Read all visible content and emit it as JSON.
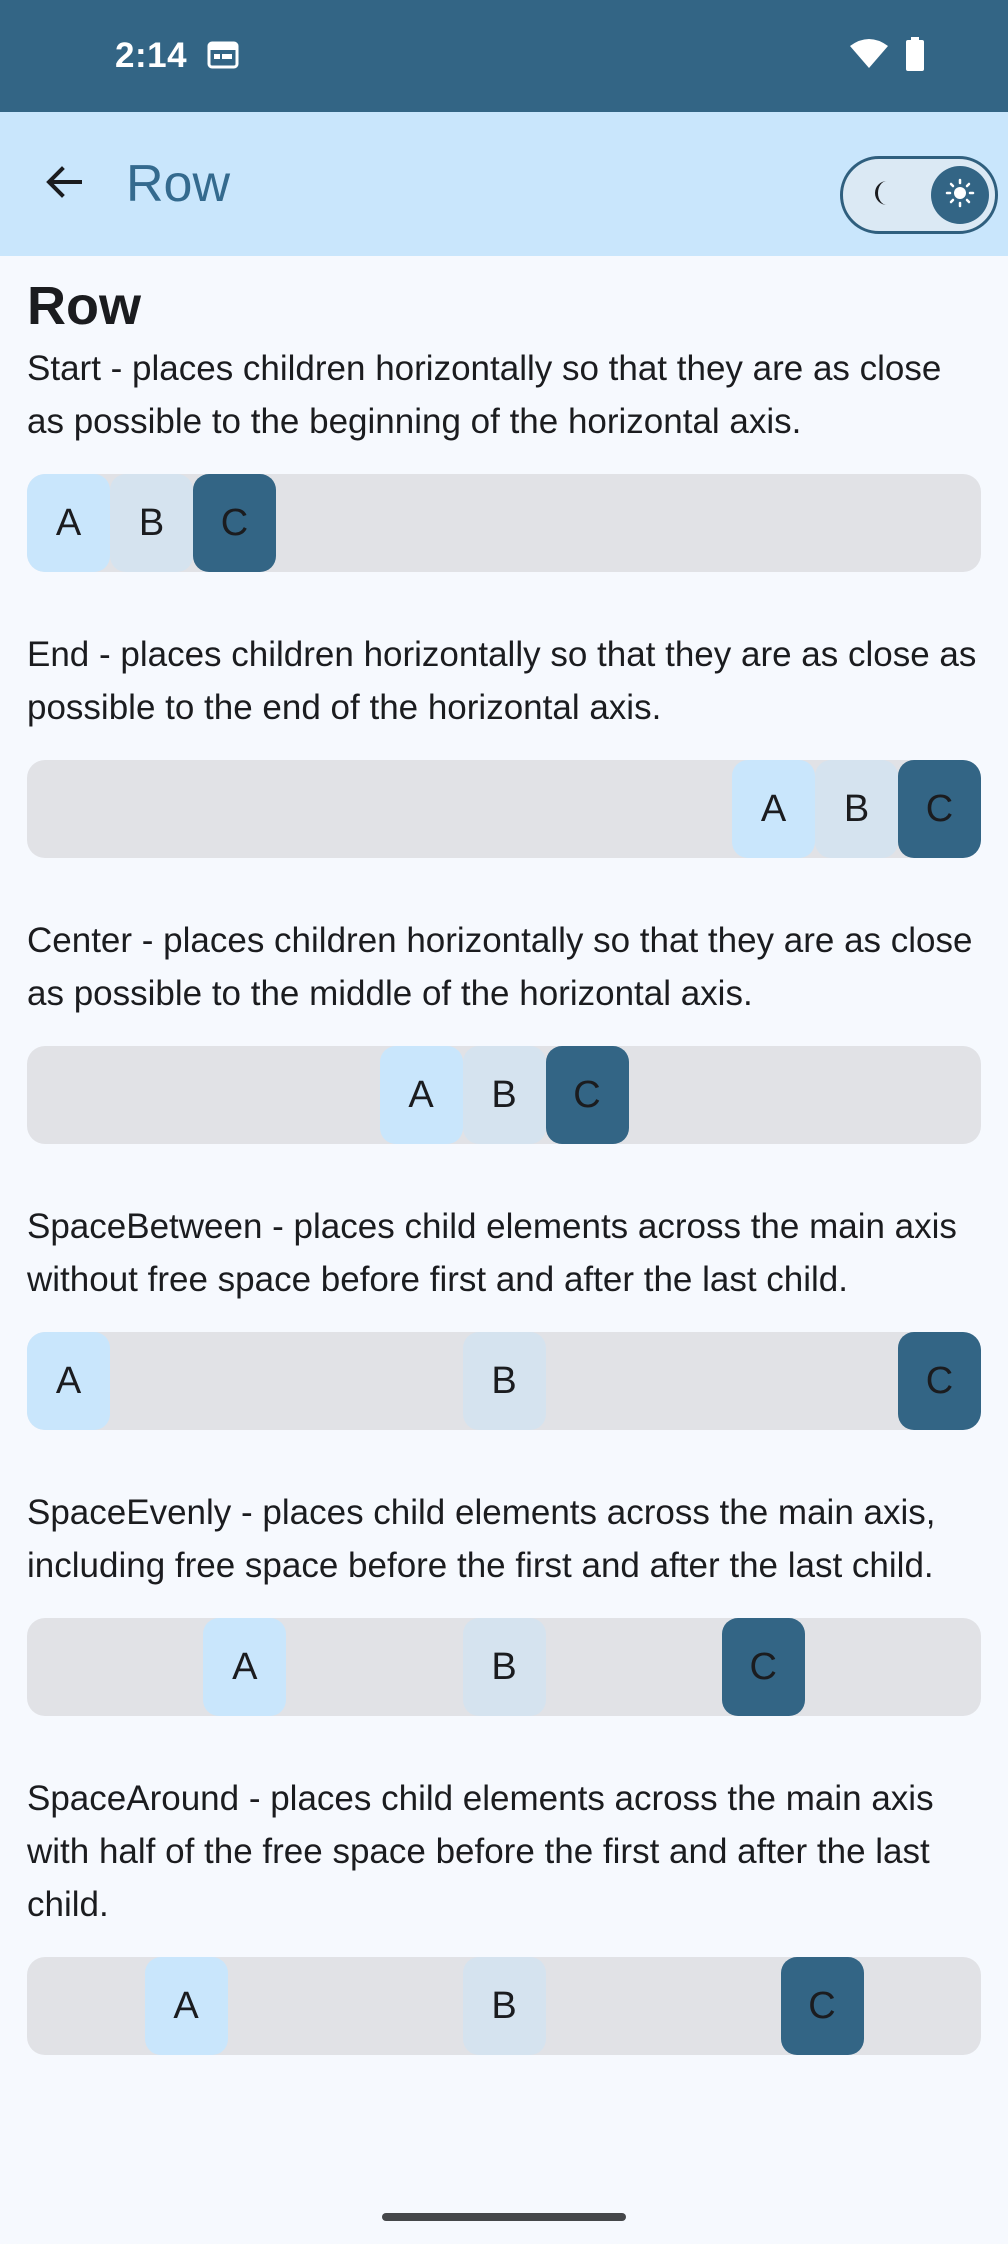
{
  "status_bar": {
    "time": "2:14",
    "icons": [
      "calendar-icon",
      "wifi-icon",
      "battery-icon"
    ]
  },
  "app_bar": {
    "title": "Row",
    "back_icon": "arrow-back-icon",
    "theme_toggle": {
      "left_icon": "moon-icon",
      "right_icon": "sun-icon",
      "selected": "light"
    }
  },
  "colors": {
    "status_bar": "#336585",
    "app_bar": "#c9e6fc",
    "row_background": "#e1e2e6",
    "chip_a": "#c9e6fc",
    "chip_b": "#d5e3ef",
    "chip_c": "#336585"
  },
  "page": {
    "heading": "Row",
    "sections": [
      {
        "arrangement": "start",
        "description": "Start - places children horizontally so that they are as close as possible to the beginning of the horizontal axis.",
        "items": [
          "A",
          "B",
          "C"
        ]
      },
      {
        "arrangement": "end",
        "description": "End - places children horizontally so that they are as close as possible to the end of the horizontal axis.",
        "items": [
          "A",
          "B",
          "C"
        ]
      },
      {
        "arrangement": "center",
        "description": "Center - places children horizontally so that they are as close as possible to the middle of the horizontal axis.",
        "items": [
          "A",
          "B",
          "C"
        ]
      },
      {
        "arrangement": "space-between",
        "description": "SpaceBetween - places child elements across the main axis without free space before first and after the last child.",
        "items": [
          "A",
          "B",
          "C"
        ]
      },
      {
        "arrangement": "space-evenly",
        "description": "SpaceEvenly - places child elements across the main axis, including free space before the first and after the last child.",
        "items": [
          "A",
          "B",
          "C"
        ]
      },
      {
        "arrangement": "space-around",
        "description": "SpaceAround - places child elements across the main axis with half of the free space before the first and after the last child.",
        "items": [
          "A",
          "B",
          "C"
        ]
      }
    ]
  }
}
